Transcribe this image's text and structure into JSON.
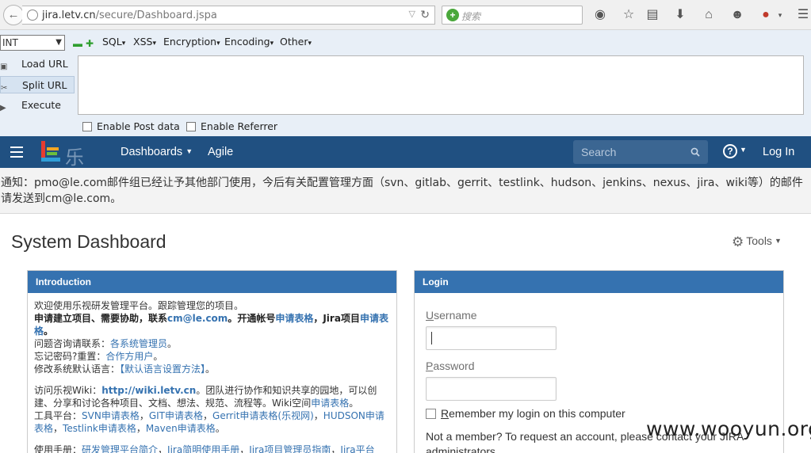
{
  "browser": {
    "url_host": "jira.letv.cn",
    "url_path": "/secure/Dashboard.jspa",
    "search_placeholder": "搜索"
  },
  "hackbar": {
    "type_select": "INT",
    "menus": [
      "SQL",
      "XSS",
      "Encryption",
      "Encoding",
      "Other"
    ],
    "load_url": "Load URL",
    "split_url": "Split URL",
    "execute": "Execute",
    "post_data": "Enable Post data",
    "referrer": "Enable Referrer"
  },
  "header": {
    "logo_text": "乐视",
    "dashboards": "Dashboards",
    "agile": "Agile",
    "search_placeholder": "Search",
    "login": "Log In"
  },
  "notice": {
    "text": "通知：pmo@le.com邮件组已经让予其他部门使用，今后有关配置管理方面（svn、gitlab、gerrit、testlink、hudson、jenkins、nexus、jira、wiki等）的邮件请发送到cm@le.com。"
  },
  "page": {
    "title": "System Dashboard",
    "tools": "Tools"
  },
  "intro": {
    "heading": "Introduction",
    "l1": "欢迎使用乐视研发管理平台。跟踪管理您的项目。",
    "l2a": "申请建立项目、需要协助，联系",
    "l2b": "cm@le.com",
    "l2c": "。开通帐号",
    "l2d": "申请表格",
    "l2e": "，Jira项目",
    "l2f": "申请表格",
    "l2g": "。",
    "l3a": "问题咨询请联系：",
    "l3b": "各系统管理员",
    "l3c": "。",
    "l4a": "忘记密码?重置：",
    "l4b": "合作方用户",
    "l4c": "。",
    "l5a": "修改系统默认语言：",
    "l5b": "【默认语言设置方法】",
    "l5c": "。",
    "l6a": "访问乐视Wiki：",
    "l6b": "http://wiki.letv.cn",
    "l6c": "。团队进行协作和知识共享的园地，可以创建、分享和讨论各种项目、文档、想法、规范、流程等。Wiki空间",
    "l6d": "申请表格",
    "l6e": "。",
    "l7a": "工具平台：",
    "l7b": "SVN申请表格",
    "l7c": "，",
    "l7d": "GIT申请表格",
    "l7e": "，",
    "l7f": "Gerrit申请表格(乐视网)",
    "l7g": "，",
    "l7h": "HUDSON申请表格",
    "l7i": "，",
    "l7j": "Testlink申请表格",
    "l7k": "，",
    "l7l": "Maven申请表格",
    "l7m": "。",
    "l8a": "使用手册：",
    "l8b": "研发管理平台简介",
    "l8c": "，",
    "l8d": "Jira简明使用手册",
    "l8e": "，",
    "l8f": "Jira项目管理员指南",
    "l8g": "，",
    "l8h": "Jira平台"
  },
  "login": {
    "heading": "Login",
    "username_u": "U",
    "username_rest": "sername",
    "password_u": "P",
    "password_rest": "assword",
    "remember_u": "R",
    "remember_rest": "emember my login on this computer",
    "note": "Not a member? To request an account, please contact your JIRA administrators."
  },
  "watermark": "www.wooyun.org",
  "colors": {
    "header_bg": "#205081",
    "gadget_head": "#3572b0",
    "link": "#3572b0",
    "hackbar_bg": "#e8eff7"
  }
}
